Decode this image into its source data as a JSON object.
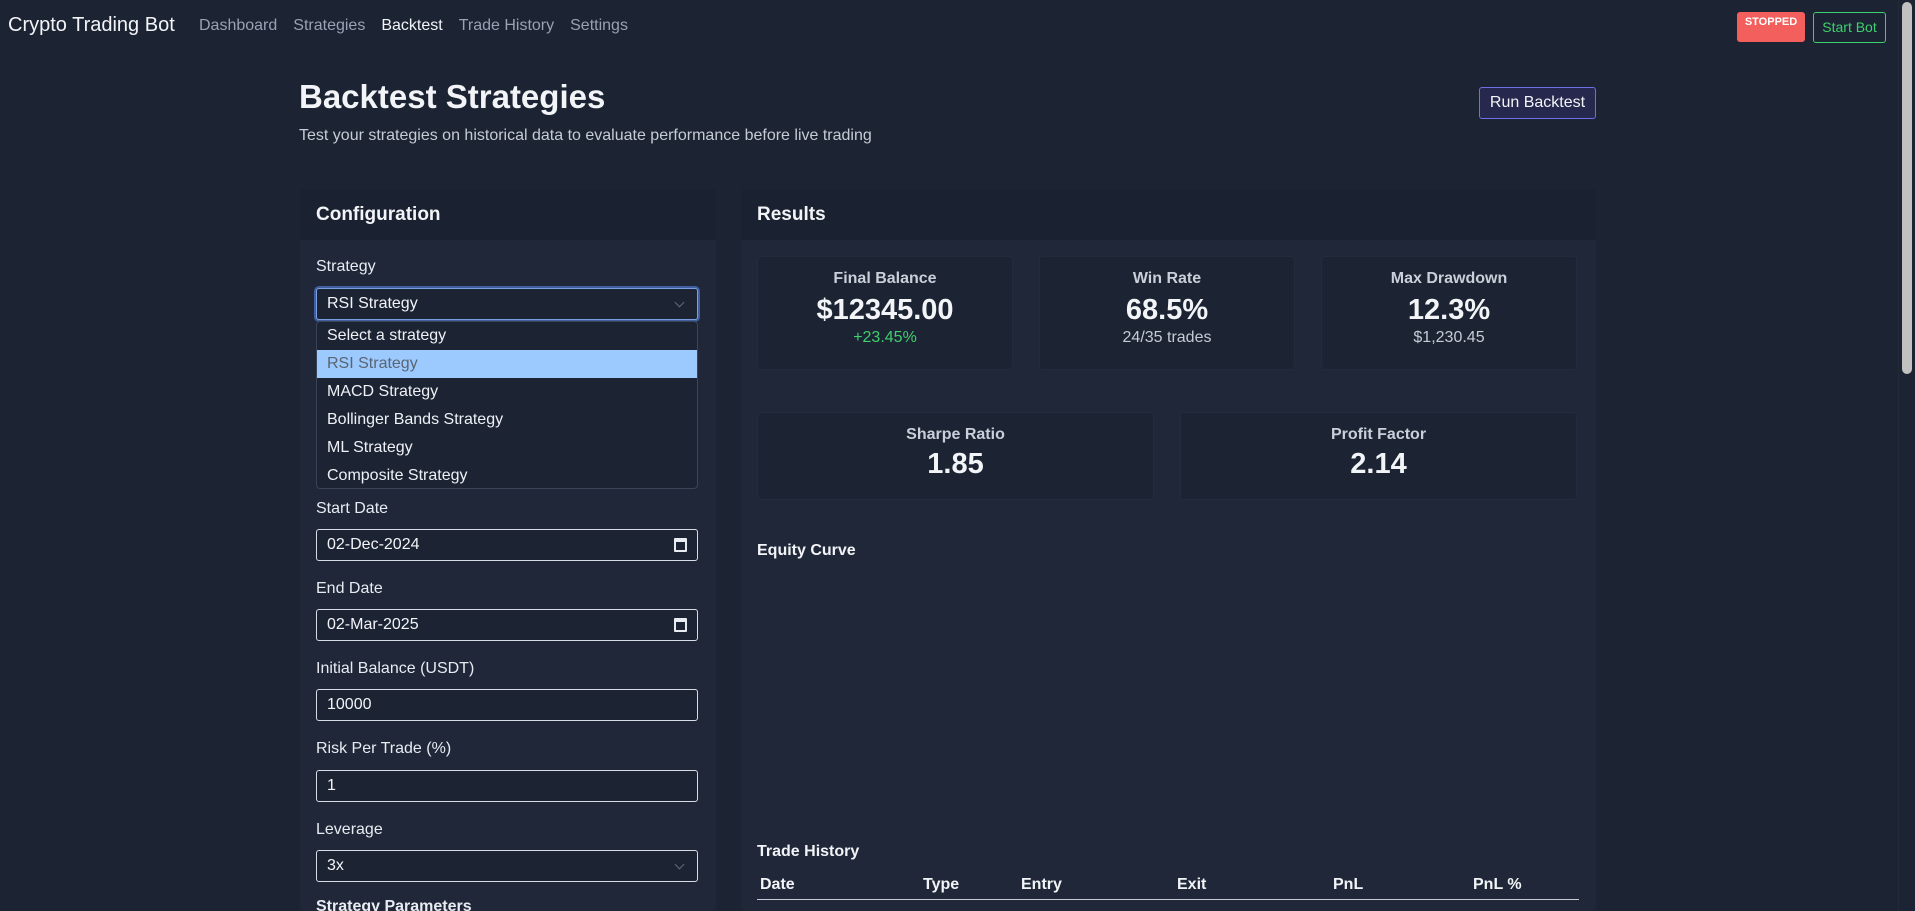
{
  "app": {
    "title": "Crypto Trading Bot"
  },
  "nav": {
    "items": [
      "Dashboard",
      "Strategies",
      "Backtest",
      "Trade History",
      "Settings"
    ],
    "active": "Backtest"
  },
  "header_right": {
    "status": "STOPPED",
    "start_button": "Start Bot"
  },
  "page": {
    "title": "Backtest Strategies",
    "subtitle": "Test your strategies on historical data to evaluate performance before live trading",
    "run_button": "Run Backtest"
  },
  "config": {
    "title": "Configuration",
    "strategy_label": "Strategy",
    "strategy_value": "RSI Strategy",
    "strategy_options": [
      "Select a strategy",
      "RSI Strategy",
      "MACD Strategy",
      "Bollinger Bands Strategy",
      "ML Strategy",
      "Composite Strategy"
    ],
    "start_date_label": "Start Date",
    "start_date_value": "02-Dec-2024",
    "end_date_label": "End Date",
    "end_date_value": "02-Mar-2025",
    "initial_balance_label": "Initial Balance (USDT)",
    "initial_balance_value": "10000",
    "risk_label": "Risk Per Trade (%)",
    "risk_value": "1",
    "leverage_label": "Leverage",
    "leverage_value": "3x",
    "params_label": "Strategy Parameters"
  },
  "results": {
    "title": "Results",
    "final_balance": {
      "label": "Final Balance",
      "value": "$12345.00",
      "sub": "+23.45%"
    },
    "win_rate": {
      "label": "Win Rate",
      "value": "68.5%",
      "sub": "24/35 trades"
    },
    "max_drawdown": {
      "label": "Max Drawdown",
      "value": "12.3%",
      "sub": "$1,230.45"
    },
    "sharpe": {
      "label": "Sharpe Ratio",
      "value": "1.85"
    },
    "profit_factor": {
      "label": "Profit Factor",
      "value": "2.14"
    },
    "equity_title": "Equity Curve",
    "trade_history_title": "Trade History",
    "table_headers": [
      "Date",
      "Type",
      "Entry",
      "Exit",
      "PnL",
      "PnL %"
    ]
  },
  "colors": {
    "background": "#1c2433",
    "stopped": "#f25f5c",
    "accent_green": "#3ecf6e",
    "run_button_border": "#6f6fe8",
    "selected_option": "#9ccaff"
  }
}
